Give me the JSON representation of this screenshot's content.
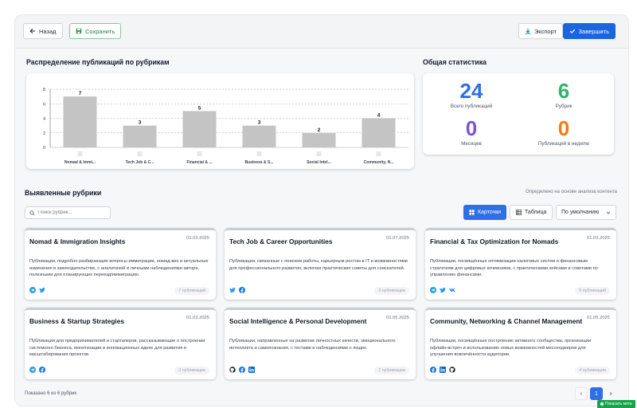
{
  "toolbar": {
    "back_label": "Назад",
    "save_label": "Сохранить",
    "export_label": "Экспорт",
    "finish_label": "Завершить"
  },
  "chart_section": {
    "title": "Распределение публикаций по рубрикам"
  },
  "chart_data": {
    "type": "bar",
    "categories": [
      "Nomad & Immi...",
      "Tech Job & C...",
      "Financial & ...",
      "Business & S...",
      "Social Intel...",
      "Community, N..."
    ],
    "values": [
      7,
      3,
      5,
      3,
      2,
      4
    ],
    "ylim": [
      0,
      8
    ],
    "yticks": [
      "0",
      "2",
      "4",
      "6",
      "8"
    ],
    "grid": true,
    "bar_color": "#c4c4c4"
  },
  "stats": {
    "title": "Общая статистика",
    "items": [
      {
        "value": "24",
        "label": "Всего публикаций",
        "color": "#2f6fe6"
      },
      {
        "value": "6",
        "label": "Рубрик",
        "color": "#2fb36b"
      },
      {
        "value": "0",
        "label": "Месяцев",
        "color": "#7b54d6"
      },
      {
        "value": "0",
        "label": "Публикаций в неделю",
        "color": "#f07c14"
      }
    ]
  },
  "rubrics": {
    "title": "Выявленные рубрики",
    "hint": "Определено на основе анализа контента",
    "search_placeholder": "Поиск рубрик...",
    "view_cards": "Карточки",
    "view_table": "Таблица",
    "sort_label": "По умолчанию",
    "cards": [
      {
        "title": "Nomad & Immigration Insights",
        "date": "01.03.2025",
        "desc": "Публикации, подробно разбирающие вопросы иммиграции, номад-виз и актуальные изменения в законодательстве, с аналитикой и личными наблюдениями автора, полезными для планирующих переезд/иммиграцию.",
        "icons": [
          "telegram-icon",
          "twitter-icon"
        ],
        "count": "7 публикаций"
      },
      {
        "title": "Tech Job & Career Opportunities",
        "date": "01.07.2025",
        "desc": "Публикации, связанные с поиском работы, карьерным ростом в IT и возможностями для профессионального развития, включая практические советы для соискателей.",
        "icons": [
          "twitter-icon",
          "facebook-icon"
        ],
        "count": "3 публикации"
      },
      {
        "title": "Financial & Tax Optimization for Nomads",
        "date": "01.03.2025",
        "desc": "Публикации, посвящённые оптимизации налоговых систем и финансовым стратегиям для цифровых кочевников, с практическими кейсами и советами по управлению финансами.",
        "icons": [
          "telegram-icon",
          "twitter-icon",
          "vk-icon"
        ],
        "count": "5 публикаций"
      },
      {
        "title": "Business & Startup Strategies",
        "date": "01.03.2025",
        "desc": "Публикации для предпринимателей и стартаперов, рассказывающие о построении системного бизнеса, монетизации и инновационных идеях для развития и масштабирования проектов.",
        "icons": [
          "telegram-icon",
          "facebook-icon"
        ],
        "count": "3 публикации"
      },
      {
        "title": "Social Intelligence & Personal Development",
        "date": "01.05.2025",
        "desc": "Публикации, направленные на развитие личностных качеств, эмоционального интеллекта и самопознания, с тестами и наблюдениями о людях.",
        "icons": [
          "github-icon",
          "facebook-icon",
          "linkedin-icon"
        ],
        "count": "2 публикации"
      },
      {
        "title": "Community, Networking & Channel Management",
        "date": "01.05.2025",
        "desc": "Публикации, посвящённые построению активного сообщества, организации офлайн-встреч и использованию новых возможностей мессенджеров для улучшения вовлечённости аудитории.",
        "icons": [
          "facebook-icon",
          "linkedin-icon",
          "github-icon"
        ],
        "count": "4 публикации"
      }
    ]
  },
  "footer": {
    "shown_text": "Показано 6 из 6 рубрик",
    "page": "1"
  },
  "feedback": {
    "label": "Показать мета"
  }
}
